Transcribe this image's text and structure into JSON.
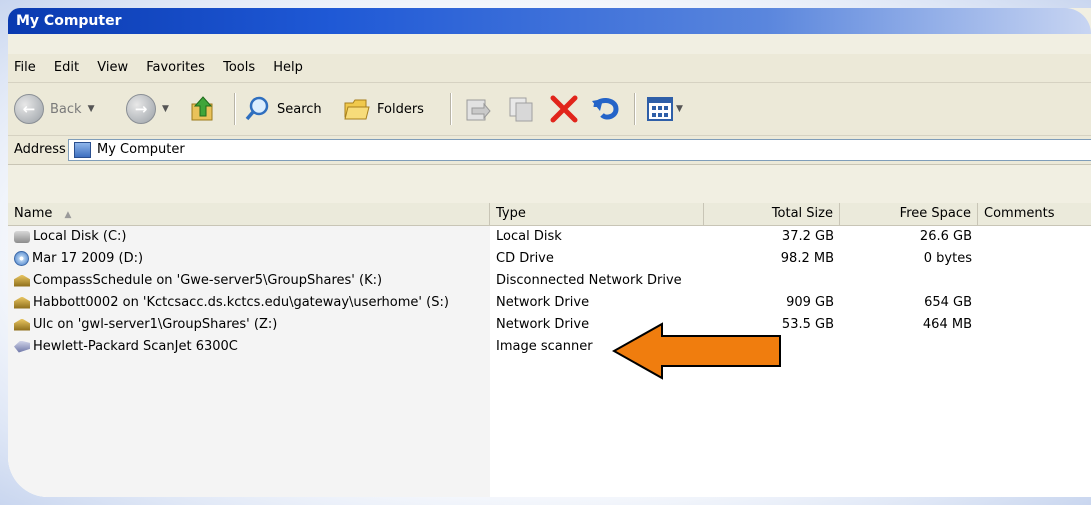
{
  "window": {
    "title": "My Computer"
  },
  "menu": [
    "File",
    "Edit",
    "View",
    "Favorites",
    "Tools",
    "Help"
  ],
  "toolbar": {
    "back_label": "Back",
    "search_label": "Search",
    "folders_label": "Folders"
  },
  "address": {
    "label": "Address",
    "value": "My Computer"
  },
  "columns": {
    "name": "Name",
    "type": "Type",
    "total": "Total Size",
    "free": "Free Space",
    "comments": "Comments"
  },
  "rows": [
    {
      "name": "Local Disk (C:)",
      "icon": "hard-disk-icon",
      "type": "Local Disk",
      "total": "37.2 GB",
      "free": "26.6 GB"
    },
    {
      "name": "Mar 17 2009 (D:)",
      "icon": "cd-drive-icon",
      "type": "CD Drive",
      "total": "98.2 MB",
      "free": "0 bytes"
    },
    {
      "name": "CompassSchedule on 'Gwe-server5\\GroupShares' (K:)",
      "icon": "network-drive-icon",
      "type": "Disconnected Network Drive",
      "total": "",
      "free": ""
    },
    {
      "name": "Habbott0002 on 'Kctcsacc.ds.kctcs.edu\\gateway\\userhome' (S:)",
      "icon": "network-drive-icon",
      "type": "Network Drive",
      "total": "909 GB",
      "free": "654 GB"
    },
    {
      "name": "Ulc on 'gwl-server1\\GroupShares' (Z:)",
      "icon": "network-drive-icon",
      "type": "Network Drive",
      "total": "53.5 GB",
      "free": "464 MB"
    },
    {
      "name": "Hewlett-Packard ScanJet 6300C",
      "icon": "scanner-icon",
      "type": "Image scanner",
      "total": "",
      "free": ""
    }
  ],
  "colors": {
    "title_bar": "#1f59d6",
    "arrow_fill": "#f07d0e",
    "arrow_stroke": "#000000"
  }
}
